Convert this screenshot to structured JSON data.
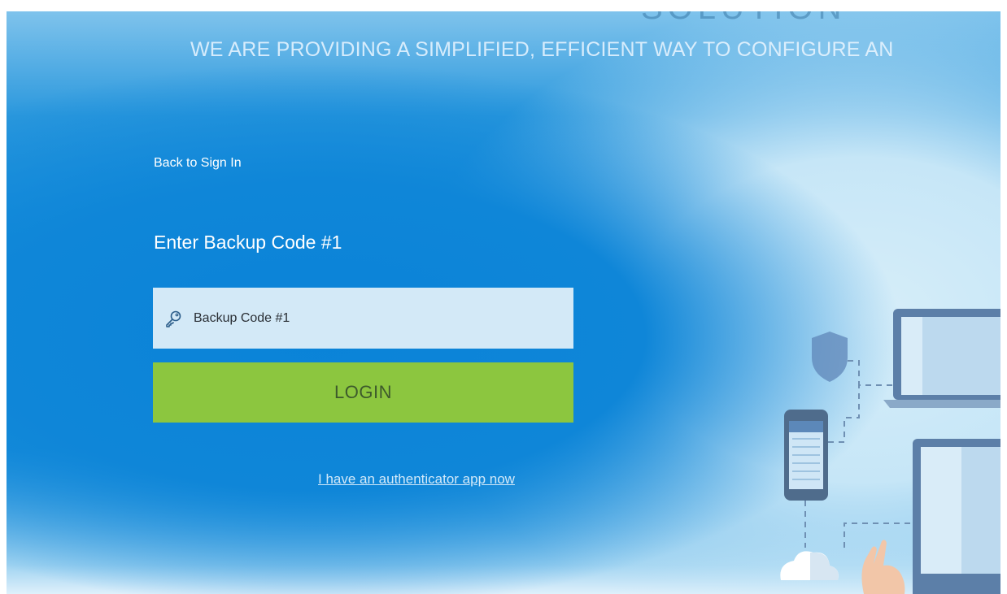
{
  "banner": {
    "heading_fragment": "SOLUTION",
    "tagline": "WE ARE PROVIDING A SIMPLIFIED, EFFICIENT WAY TO CONFIGURE AN"
  },
  "form": {
    "back_link": "Back to Sign In",
    "title": "Enter Backup Code #1",
    "input_placeholder": "Backup Code #1",
    "input_value": "",
    "login_label": "LOGIN",
    "authenticator_link": "I have an authenticator app now"
  },
  "icons": {
    "input_icon": "key-icon",
    "illustration": [
      "shield-icon",
      "laptop-icon",
      "smartphone-icon",
      "monitor-icon",
      "cloud-icon",
      "hand-icon"
    ]
  },
  "colors": {
    "background_blue": "#118bdb",
    "input_background": "#d3e9f7",
    "login_green": "#8cc63f",
    "login_text": "#3d5a2c",
    "link_text": "#d2e9f9"
  }
}
